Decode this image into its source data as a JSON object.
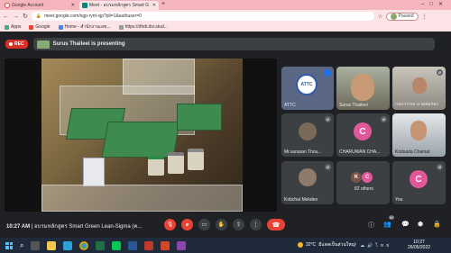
{
  "tabs": [
    {
      "title": "Google Account",
      "icon": "google-icon"
    },
    {
      "title": "Meet - อบรมหลักสูตร Smart G",
      "icon": "meet-icon"
    }
  ],
  "address_bar": {
    "url": "meet.google.com/xgp-rynt-vjp?pli=1&authuser=0",
    "profile_status": "Paused"
  },
  "bookmarks": [
    "Apps",
    "Google",
    "Home - สำนักงานเลข...",
    "https://dhdi.dsi.stud..."
  ],
  "recording": {
    "label": "REC"
  },
  "presenter_banner": "Surus Thaileei is presenting",
  "participants": [
    {
      "name": "ATTC",
      "type": "logo"
    },
    {
      "name": "Surus Thaileei",
      "type": "video"
    },
    {
      "name": "กนกวรรณ นามสมร่อง",
      "type": "video"
    },
    {
      "name": "Mr.surasan Thou...",
      "type": "avatar-image"
    },
    {
      "name": "CHARUWAN CHA...",
      "type": "initial",
      "initial": "C",
      "color": "#e0579a"
    },
    {
      "name": "Kridsada Chaniat",
      "type": "video"
    },
    {
      "name": "Kobchai Mekdee",
      "type": "avatar-image"
    },
    {
      "name": "82 others",
      "type": "others",
      "initials": [
        "K",
        "C"
      ]
    },
    {
      "name": "You",
      "type": "initial",
      "initial": "C",
      "color": "#e0579a"
    }
  ],
  "meeting": {
    "time": "10:27 AM",
    "separator": "|",
    "title": "อบรมหลักสูตร Smart Green Lean-Sigma (ค..."
  },
  "participant_count": "85",
  "taskbar": {
    "weather": "32°C",
    "weather_desc": "มีแดดเป็นส่วนใหญ่",
    "time": "10:27",
    "date": "26/05/2022"
  },
  "colors": {
    "accent": "#1a73e8",
    "danger": "#ea4335",
    "meet_bg": "#202124",
    "chrome_tab": "#f5b5bd"
  }
}
